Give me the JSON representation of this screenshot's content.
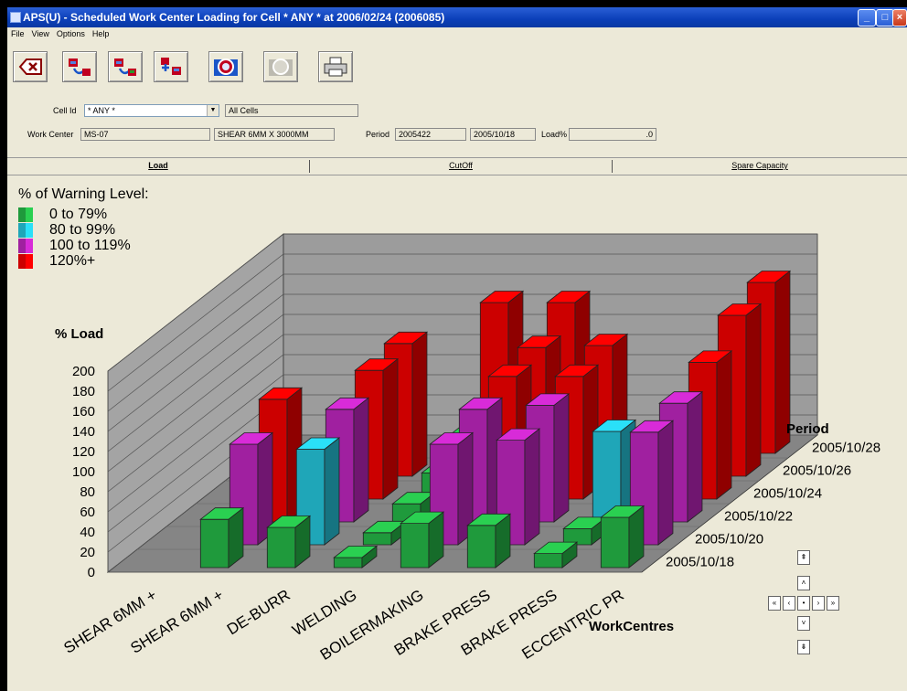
{
  "window": {
    "title": "APS(U) - Scheduled Work Center Loading for Cell * ANY * at 2006/02/24 (2006085)"
  },
  "menu": {
    "file": "File",
    "view": "View",
    "options": "Options",
    "help": "Help"
  },
  "toolbar": {
    "icons": [
      "delete-icon",
      "load-prev-icon",
      "load-next-icon",
      "add-work-center-icon",
      "zoom-chart-icon",
      "zoom-disabled-icon",
      "print-icon"
    ]
  },
  "form": {
    "cell_label": "Cell Id",
    "cell_value": "* ANY *",
    "cell_desc": "All Cells",
    "wc_label": "Work Center",
    "wc_value": "MS-07",
    "wc_desc": "SHEAR 6MM X 3000MM",
    "period_label": "Period",
    "period_value": "2005422",
    "period_date": "2005/10/18",
    "load_label": "Load%",
    "load_value": ".0"
  },
  "tabs": {
    "load": "Load",
    "cutoff": "CutOff",
    "spare": "Spare Capacity"
  },
  "chart_data": {
    "type": "bar",
    "legend_title": "% of Warning Level:",
    "legend": [
      {
        "label": "0 to 79%",
        "color": "#1f9a3c"
      },
      {
        "label": "80 to 99%",
        "color": "#1fa6b8"
      },
      {
        "label": "100 to 119%",
        "color": "#a020a0"
      },
      {
        "label": "120%+",
        "color": "#cc0000"
      }
    ],
    "ylabel": "% Load",
    "ylim": [
      0,
      200
    ],
    "yticks": [
      "200",
      "180",
      "160",
      "140",
      "120",
      "100",
      "80",
      "60",
      "40",
      "20",
      "0"
    ],
    "xlabel": "WorkCentres",
    "categories": [
      "SHEAR 6MM +",
      "SHEAR 6MM +",
      "DE-BURR",
      "WELDING",
      "BOILERMAKING",
      "BRAKE PRESS",
      "BRAKE PRESS",
      "ECCENTRIC PR"
    ],
    "zlabel": "Period",
    "periods": [
      "2005/10/18",
      "2005/10/20",
      "2005/10/22",
      "2005/10/24",
      "2005/10/26",
      "2005/10/28"
    ]
  },
  "nav": {
    "first": "«",
    "prev": "‹",
    "center": "•",
    "next": "›",
    "last": "»",
    "top": "⇞",
    "up": "˄",
    "down": "˅",
    "bottom": "⇟"
  }
}
